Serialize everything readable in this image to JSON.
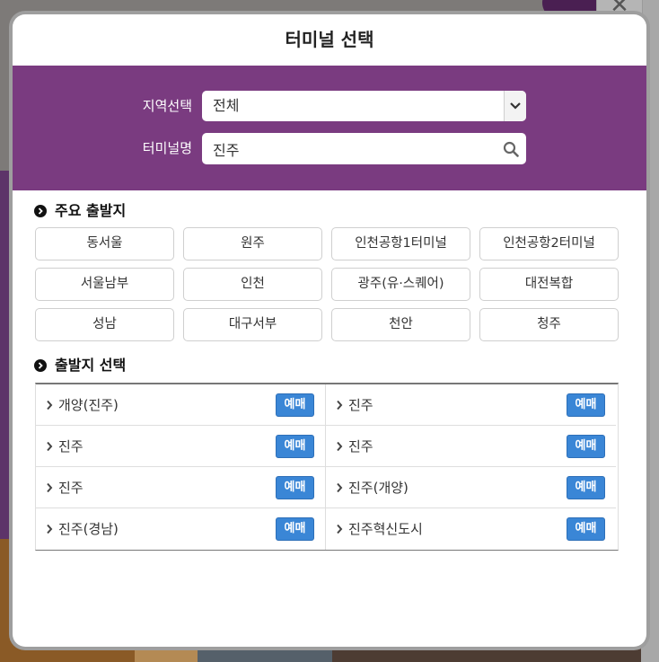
{
  "modal": {
    "title": "터미널 선택"
  },
  "search": {
    "region_label": "지역선택",
    "region_value": "전체",
    "terminal_label": "터미널명",
    "terminal_value": "진주"
  },
  "quick_section": {
    "title": "주요 출발지",
    "items": [
      "동서울",
      "원주",
      "인천공항1터미널",
      "인천공항2터미널",
      "서울남부",
      "인천",
      "광주(유·스퀘어)",
      "대전복합",
      "성남",
      "대구서부",
      "천안",
      "청주"
    ]
  },
  "departure_section": {
    "title": "출발지 선택",
    "book_label": "예매",
    "rows": [
      [
        "개양(진주)",
        "진주"
      ],
      [
        "진주",
        "진주"
      ],
      [
        "진주",
        "진주(개양)"
      ],
      [
        "진주(경남)",
        "진주혁신도시"
      ]
    ]
  },
  "colors": {
    "panel_purple": "#7a3b80",
    "book_button_blue": "#3a86d6"
  },
  "icons": {
    "dropdown": "chevron-down-icon",
    "search": "search-icon",
    "bullet": "chevron-right-circle-icon",
    "row_marker": "chevron-right-icon"
  }
}
